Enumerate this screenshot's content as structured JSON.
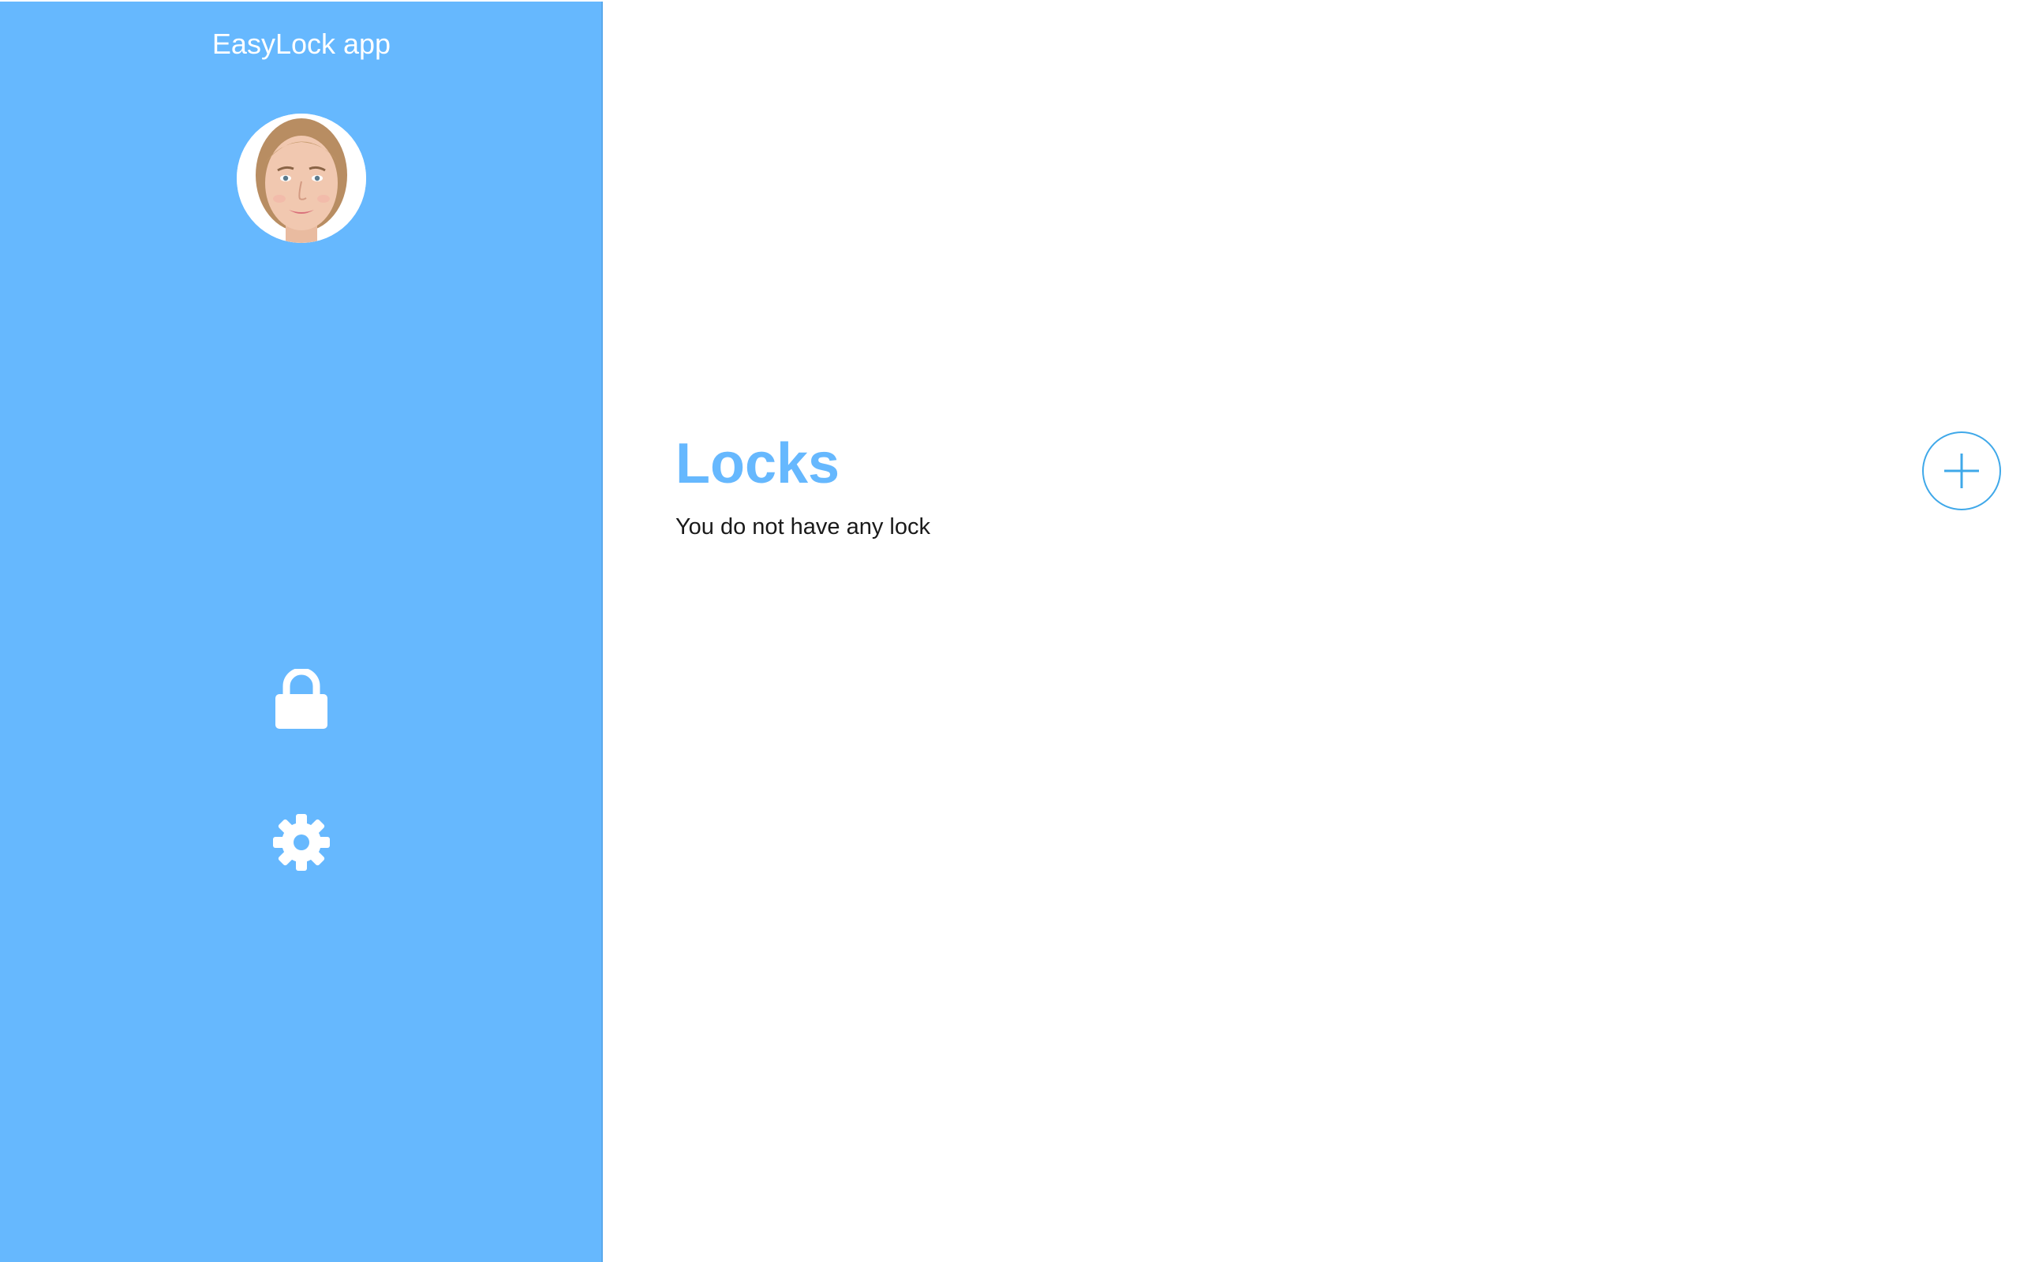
{
  "app": {
    "title": "EasyLock app"
  },
  "sidebar": {
    "avatar_alt": "User avatar",
    "nav": [
      {
        "id": "locks",
        "icon": "lock-icon"
      },
      {
        "id": "settings",
        "icon": "gear-icon"
      }
    ]
  },
  "main": {
    "title": "Locks",
    "empty_message": "You do not have any lock",
    "add_button": {
      "icon": "plus-icon"
    }
  },
  "colors": {
    "sidebar_bg": "#66b8fe",
    "accent": "#66b8fe",
    "add_button_border": "#3fa8e9",
    "text": "#1a1a1a",
    "white": "#ffffff"
  }
}
